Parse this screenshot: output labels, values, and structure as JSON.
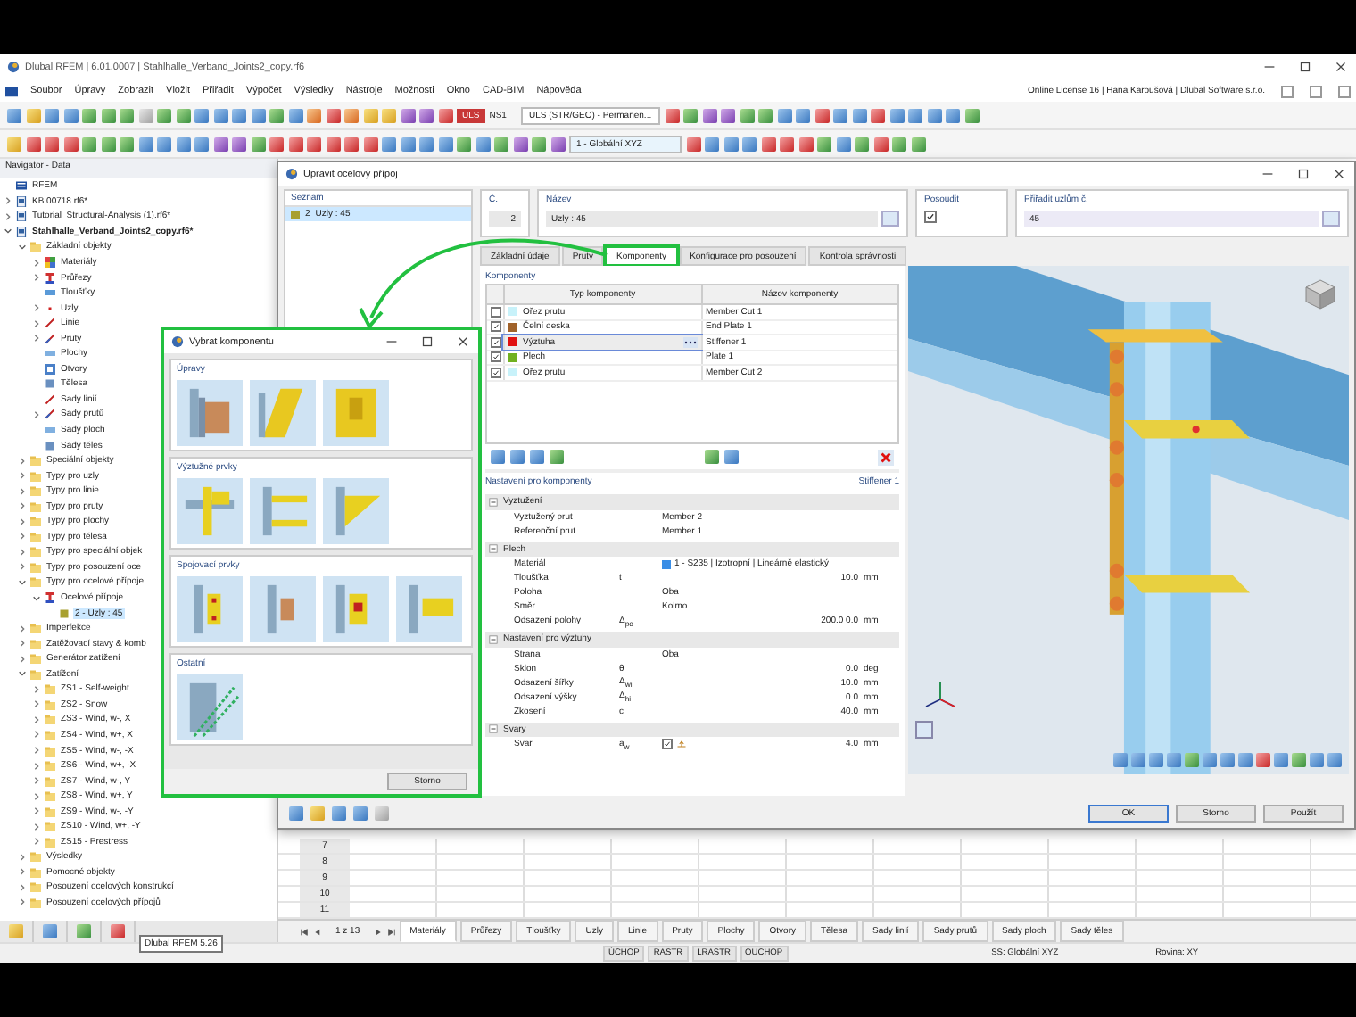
{
  "window": {
    "title": "Dlubal RFEM | 6.01.0007 | Stahlhalle_Verband_Joints2_copy.rf6"
  },
  "menu": [
    "Soubor",
    "Úpravy",
    "Zobrazit",
    "Vložit",
    "Přiřadit",
    "Výpočet",
    "Výsledky",
    "Nástroje",
    "Možnosti",
    "Okno",
    "CAD-BIM",
    "Nápověda"
  ],
  "license": "Online License 16 | Hana Karoušová | Dlubal Software s.r.o.",
  "toolbar": {
    "load_badge": "ULS",
    "load_case": "NS1",
    "combination": "ULS (STR/GEO) - Permanen...",
    "coordinate_system": "1 - Globální XYZ"
  },
  "navigator": {
    "title": "Navigator - Data",
    "tree": [
      {
        "label": "RFEM",
        "kind": "root",
        "selected": false
      },
      {
        "label": "KB 00718.rf6*",
        "kind": "file",
        "expanded": false,
        "selected": false
      },
      {
        "label": "Tutorial_Structural-Analysis (1).rf6*",
        "kind": "file",
        "expanded": false,
        "selected": false
      },
      {
        "label": "Stahlhalle_Verband_Joints2_copy.rf6*",
        "kind": "file",
        "expanded": true,
        "active": true,
        "selected": false,
        "children": [
          {
            "label": "Základní objekty",
            "kind": "folder",
            "expanded": true,
            "selected": false,
            "children": [
              {
                "label": "Materiály",
                "kind": "materials",
                "expanded": false,
                "selected": false
              },
              {
                "label": "Průřezy",
                "kind": "sections",
                "expanded": false,
                "selected": false
              },
              {
                "label": "Tloušťky",
                "kind": "thickness",
                "selected": false
              },
              {
                "label": "Uzly",
                "kind": "nodes",
                "expanded": false,
                "selected": false
              },
              {
                "label": "Linie",
                "kind": "lines",
                "expanded": false,
                "selected": false
              },
              {
                "label": "Pruty",
                "kind": "members",
                "expanded": false,
                "selected": false
              },
              {
                "label": "Plochy",
                "kind": "surfaces",
                "selected": false
              },
              {
                "label": "Otvory",
                "kind": "openings",
                "selected": false
              },
              {
                "label": "Tělesa",
                "kind": "solids",
                "selected": false
              },
              {
                "label": "Sady linií",
                "kind": "lines",
                "selected": false
              },
              {
                "label": "Sady prutů",
                "kind": "members",
                "expanded": false,
                "selected": false
              },
              {
                "label": "Sady ploch",
                "kind": "surfaces",
                "selected": false
              },
              {
                "label": "Sady těles",
                "kind": "solids",
                "selected": false
              }
            ]
          },
          {
            "label": "Speciální objekty",
            "kind": "folder",
            "expanded": false,
            "selected": false
          },
          {
            "label": "Typy pro uzly",
            "kind": "folder",
            "expanded": false,
            "selected": false
          },
          {
            "label": "Typy pro linie",
            "kind": "folder",
            "expanded": false,
            "selected": false
          },
          {
            "label": "Typy pro pruty",
            "kind": "folder",
            "expanded": false,
            "selected": false
          },
          {
            "label": "Typy pro plochy",
            "kind": "folder",
            "expanded": false,
            "selected": false
          },
          {
            "label": "Typy pro tělesa",
            "kind": "folder",
            "expanded": false,
            "selected": false
          },
          {
            "label": "Typy pro speciální objek",
            "kind": "folder",
            "expanded": false,
            "selected": false
          },
          {
            "label": "Typy pro posouzení oce",
            "kind": "folder",
            "expanded": false,
            "selected": false
          },
          {
            "label": "Typy pro ocelové přípoje",
            "kind": "folder",
            "expanded": true,
            "selected": false,
            "children": [
              {
                "label": "Ocelové přípoje",
                "kind": "sections",
                "expanded": true,
                "selected": false,
                "children": [
                  {
                    "label": "2 - Uzly : 45",
                    "kind": "joint",
                    "selected": true
                  }
                ]
              }
            ]
          },
          {
            "label": "Imperfekce",
            "kind": "folder",
            "expanded": false,
            "selected": false
          },
          {
            "label": "Zatěžovací stavy & komb",
            "kind": "folder",
            "expanded": false,
            "selected": false
          },
          {
            "label": "Generátor zatížení",
            "kind": "folder",
            "expanded": false,
            "selected": false
          },
          {
            "label": "Zatížení",
            "kind": "folder",
            "expanded": true,
            "selected": false,
            "children": [
              {
                "label": "ZS1 - Self-weight",
                "kind": "folder",
                "expanded": false,
                "selected": false
              },
              {
                "label": "ZS2 - Snow",
                "kind": "folder",
                "expanded": false,
                "selected": false
              },
              {
                "label": "ZS3 - Wind, w-, X",
                "kind": "folder",
                "expanded": false,
                "selected": false
              },
              {
                "label": "ZS4 - Wind, w+, X",
                "kind": "folder",
                "expanded": false,
                "selected": false
              },
              {
                "label": "ZS5 - Wind, w-, -X",
                "kind": "folder",
                "expanded": false,
                "selected": false
              },
              {
                "label": "ZS6 - Wind, w+, -X",
                "kind": "folder",
                "expanded": false,
                "selected": false
              },
              {
                "label": "ZS7 - Wind, w-, Y",
                "kind": "folder",
                "expanded": false,
                "selected": false
              },
              {
                "label": "ZS8 - Wind, w+, Y",
                "kind": "folder",
                "expanded": false,
                "selected": false
              },
              {
                "label": "ZS9 - Wind, w-, -Y",
                "kind": "folder",
                "expanded": false,
                "selected": false
              },
              {
                "label": "ZS10 - Wind, w+, -Y",
                "kind": "folder",
                "expanded": false,
                "selected": false
              },
              {
                "label": "ZS15 - Prestress",
                "kind": "folder",
                "expanded": false,
                "selected": false
              }
            ]
          },
          {
            "label": "Výsledky",
            "kind": "folder",
            "expanded": false,
            "selected": false
          },
          {
            "label": "Pomocné objekty",
            "kind": "folder",
            "expanded": false,
            "selected": false
          },
          {
            "label": "Posouzení ocelových konstrukcí",
            "kind": "folder",
            "expanded": false,
            "selected": false
          },
          {
            "label": "Posouzení ocelových přípojů",
            "kind": "folder",
            "expanded": false,
            "selected": false
          }
        ]
      }
    ]
  },
  "tooltip": "Dlubal RFEM 5.26",
  "background_table": {
    "row_numbers": [
      "7",
      "8",
      "9",
      "10",
      "11"
    ],
    "pager": "1 z 13",
    "tabs": [
      {
        "label": "Materiály",
        "selected": true
      },
      {
        "label": "Průřezy",
        "selected": false
      },
      {
        "label": "Tloušťky",
        "selected": false
      },
      {
        "label": "Uzly",
        "selected": false
      },
      {
        "label": "Linie",
        "selected": false
      },
      {
        "label": "Pruty",
        "selected": false
      },
      {
        "label": "Plochy",
        "selected": false
      },
      {
        "label": "Otvory",
        "selected": false
      },
      {
        "label": "Tělesa",
        "selected": false
      },
      {
        "label": "Sady linií",
        "selected": false
      },
      {
        "label": "Sady prutů",
        "selected": false
      },
      {
        "label": "Sady ploch",
        "selected": false
      },
      {
        "label": "Sady těles",
        "selected": false
      }
    ]
  },
  "status_bar": {
    "toggles": [
      "ÚCHOP",
      "RASTR",
      "LRASTR",
      "OUCHOP"
    ],
    "coordinate_system": "SS: Globální XYZ",
    "plane": "Rovina: XY"
  },
  "dialog": {
    "title": "Upravit ocelový přípoj",
    "list_title": "Seznam",
    "list": [
      {
        "number": "2",
        "label": "Uzly : 45",
        "color": "#a8a030",
        "selected": true
      }
    ],
    "fields": {
      "number_label": "Č.",
      "number": "2",
      "name_label": "Název",
      "name": "Uzly : 45",
      "design_label": "Posoudit",
      "design": true,
      "nodes_label": "Přiřadit uzlům č.",
      "nodes": "45"
    },
    "tabs": [
      {
        "label": "Základní údaje",
        "selected": false
      },
      {
        "label": "Pruty",
        "selected": false
      },
      {
        "label": "Komponenty",
        "selected": true
      },
      {
        "label": "Konfigurace pro posouzení",
        "selected": false
      },
      {
        "label": "Kontrola správnosti",
        "selected": false
      }
    ],
    "components": {
      "title": "Komponenty",
      "columns": [
        "Typ komponenty",
        "Název komponenty"
      ],
      "rows": [
        {
          "checked": false,
          "color": "#c8f2fa",
          "type": "Ořez prutu",
          "name": "Member Cut 1",
          "selected": false
        },
        {
          "checked": true,
          "color": "#a0622a",
          "type": "Čelní deska",
          "name": "End Plate 1",
          "selected": false
        },
        {
          "checked": true,
          "color": "#e01010",
          "type": "Výztuha",
          "name": "Stiffener 1",
          "selected": true
        },
        {
          "checked": true,
          "color": "#70b020",
          "type": "Plech",
          "name": "Plate 1",
          "selected": false
        },
        {
          "checked": true,
          "color": "#c8f2fa",
          "type": "Ořez prutu",
          "name": "Member Cut 2",
          "selected": false
        }
      ]
    },
    "settings": {
      "title": "Nastavení pro komponenty",
      "current": "Stiffener 1",
      "groups": [
        {
          "title": "Vyztužení",
          "expanded": true,
          "rows": [
            {
              "label": "Vyztužený prut",
              "value": "Member 2"
            },
            {
              "label": "Referenční prut",
              "value": "Member 1"
            }
          ]
        },
        {
          "title": "Plech",
          "expanded": true,
          "rows": [
            {
              "label": "Materiál",
              "value": "1 - S235 | Izotropní | Lineárně elastický",
              "color": "#3a8ee6"
            },
            {
              "label": "Tloušťka",
              "symbol": "t",
              "value": "10.0",
              "unit": "mm"
            },
            {
              "label": "Poloha",
              "value": "Oba"
            },
            {
              "label": "Směr",
              "value": "Kolmo"
            },
            {
              "label": "Odsazení polohy",
              "symbol": "Δ$_{po}$",
              "value": "200.0 0.0",
              "unit": "mm"
            }
          ]
        },
        {
          "title": "Nastavení pro výztuhy",
          "expanded": true,
          "rows": [
            {
              "label": "Strana",
              "value": "Oba"
            },
            {
              "label": "Sklon",
              "symbol": "θ",
              "value": "0.0",
              "unit": "deg"
            },
            {
              "label": "Odsazení šířky",
              "symbol": "Δ$_{wi}$",
              "value": "10.0",
              "unit": "mm"
            },
            {
              "label": "Odsazení výšky",
              "symbol": "Δ$_{hi}$",
              "value": "0.0",
              "unit": "mm"
            },
            {
              "label": "Zkosení",
              "symbol": "c",
              "value": "40.0",
              "unit": "mm"
            }
          ]
        },
        {
          "title": "Svary",
          "expanded": true,
          "rows": [
            {
              "label": "Svar",
              "symbol": "a$_{w}$",
              "checked": true,
              "value": "4.0",
              "unit": "mm"
            }
          ]
        }
      ]
    },
    "buttons": [
      {
        "label": "OK",
        "default": true
      },
      {
        "label": "Storno",
        "default": false
      },
      {
        "label": "Použít",
        "default": false
      }
    ]
  },
  "popup": {
    "title": "Vybrat komponentu",
    "sections": [
      {
        "title": "Úpravy",
        "items": [
          {
            "kind": "cut"
          },
          {
            "kind": "plate"
          },
          {
            "kind": "end-plate"
          }
        ]
      },
      {
        "title": "Výztužné prvky",
        "items": [
          {
            "kind": "stiffener"
          },
          {
            "kind": "flange-plates"
          },
          {
            "kind": "haunch"
          }
        ]
      },
      {
        "title": "Spojovací prvky",
        "items": [
          {
            "kind": "bolted-plate"
          },
          {
            "kind": "cleat"
          },
          {
            "kind": "splice"
          },
          {
            "kind": "fin-plate"
          }
        ]
      },
      {
        "title": "Ostatní",
        "items": [
          {
            "kind": "anchor"
          }
        ]
      }
    ],
    "button": "Storno"
  }
}
